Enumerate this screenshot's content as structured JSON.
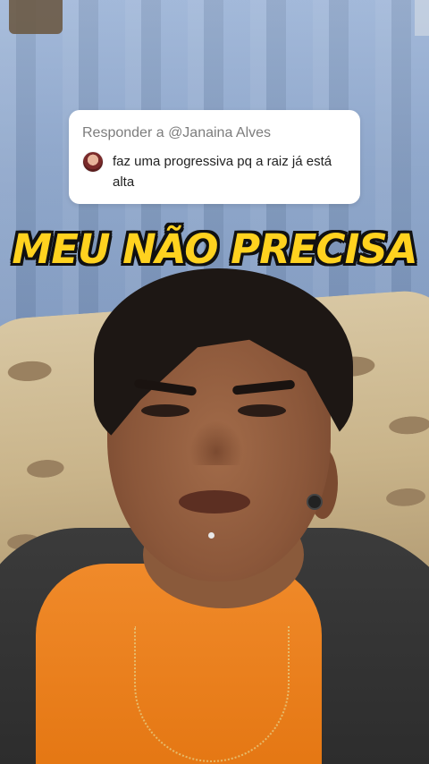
{
  "reply_sticker": {
    "header": "Responder a @Janaina Alves",
    "comment": "faz uma progressiva pq a raiz já está alta"
  },
  "caption": {
    "text": "MEU NÃO PRECISA",
    "color": "#ffd21f"
  },
  "icons": {
    "avatar": "commenter-avatar"
  }
}
